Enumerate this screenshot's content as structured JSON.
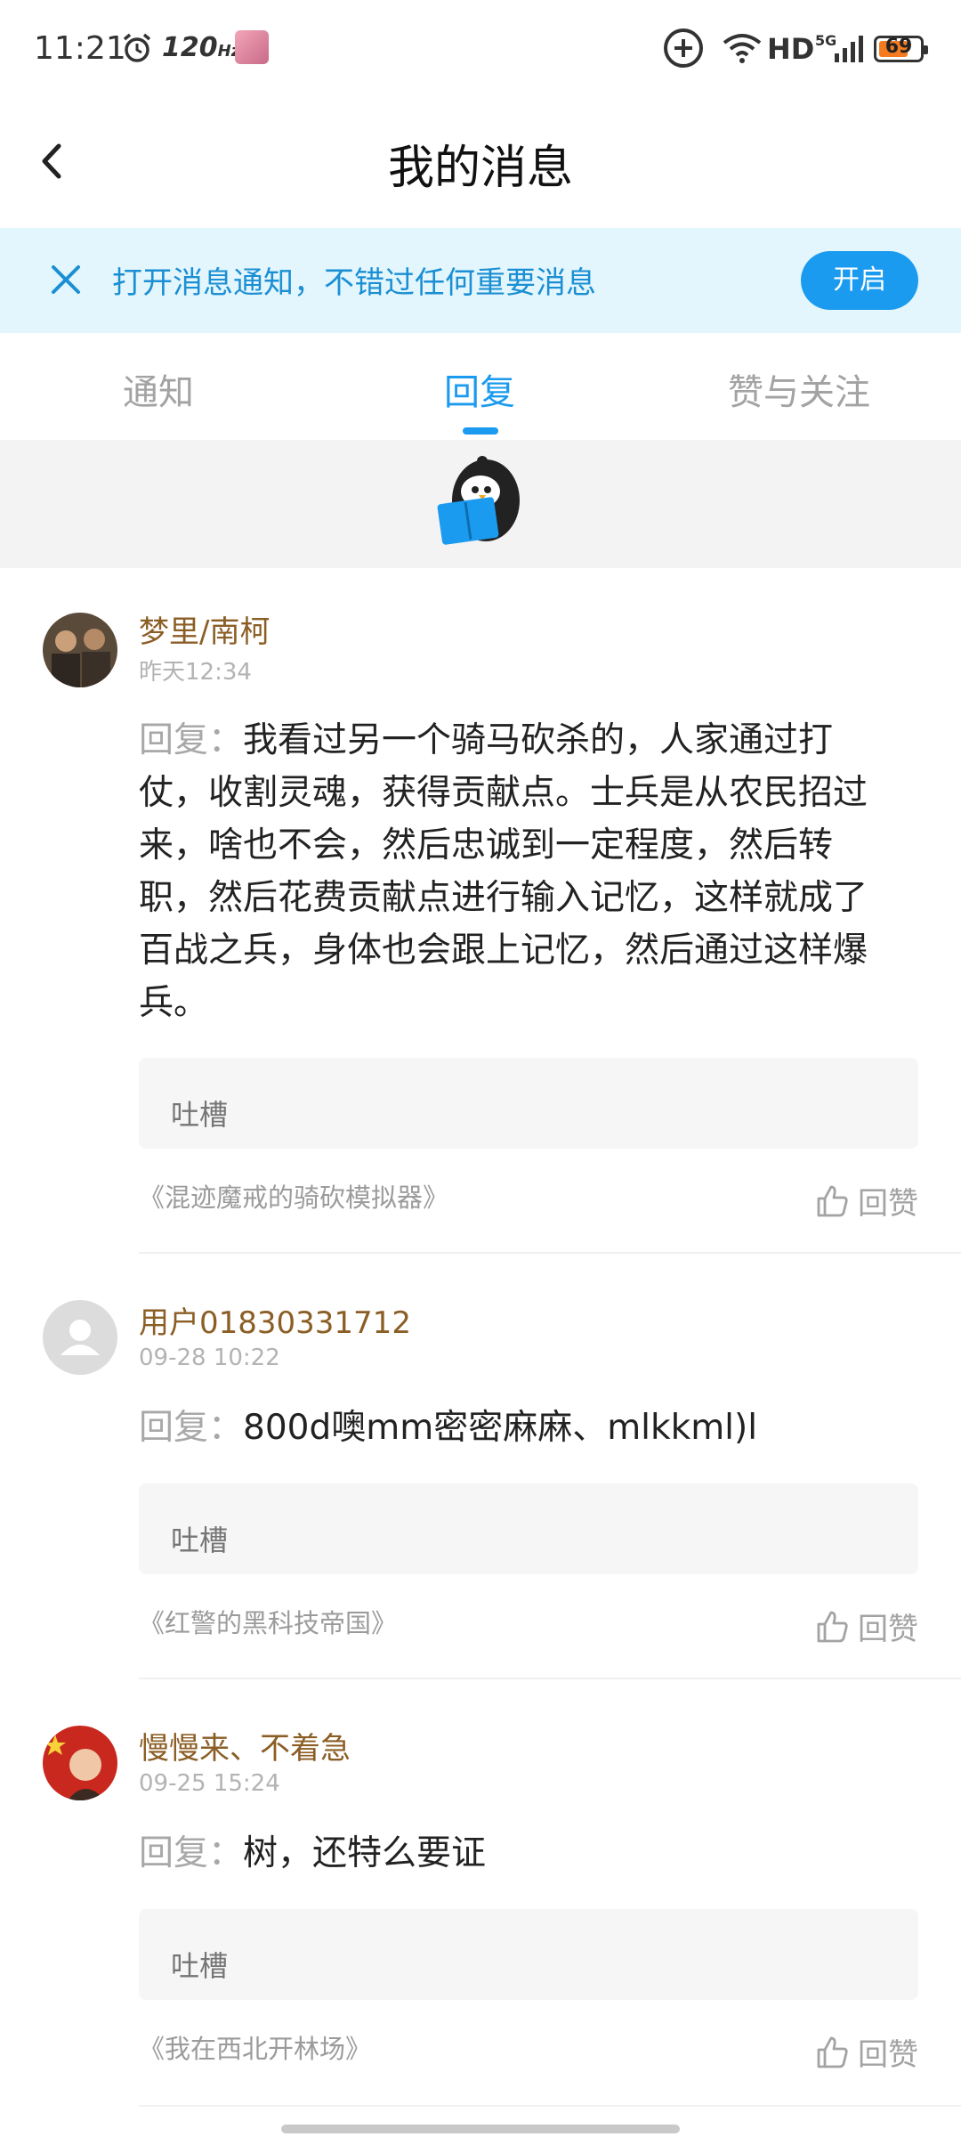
{
  "status_bar": {
    "time": "11:21",
    "refresh_rate": "120",
    "refresh_unit": "Hz",
    "network": "HD",
    "network_gen": "5G",
    "battery": "69",
    "battery_level": 0.69
  },
  "header": {
    "title": "我的消息",
    "back_icon": "chevron-left-icon"
  },
  "notice": {
    "text": "打开消息通知，不错过任何重要消息",
    "button_label": "开启"
  },
  "tabs": [
    {
      "label": "通知",
      "active": false
    },
    {
      "label": "回复",
      "active": true
    },
    {
      "label": "赞与关注",
      "active": false
    }
  ],
  "messages": [
    {
      "username": "梦里/南柯",
      "time": "昨天12:34",
      "reply_prefix": "回复：",
      "content": "我看过另一个骑马砍杀的，人家通过打仗，收割灵魂，获得贡献点。士兵是从农民招过来，啥也不会，然后忠诚到一定程度，然后转职，然后花费贡献点进行输入记忆，这样就成了百战之兵，身体也会跟上记忆，然后通过这样爆兵。",
      "comment_placeholder": "吐槽",
      "book": "《混迹魔戒的骑砍模拟器》",
      "like_label": "回赞"
    },
    {
      "username": "用户01830331712",
      "time": "09-28 10:22",
      "reply_prefix": "回复：",
      "content": "800d噢mm密密麻麻、mlkkml)l",
      "comment_placeholder": "吐槽",
      "book": "《红警的黑科技帝国》",
      "like_label": "回赞"
    },
    {
      "username": "慢慢来、不着急",
      "time": "09-25 15:24",
      "reply_prefix": "回复：",
      "content": "树，还特么要证",
      "comment_placeholder": "吐槽",
      "book": "《我在西北开林场》",
      "like_label": "回赞"
    }
  ],
  "colors": {
    "accent": "#1a9bef",
    "notice_bg": "#e3f6fd",
    "username": "#8b5e25"
  }
}
